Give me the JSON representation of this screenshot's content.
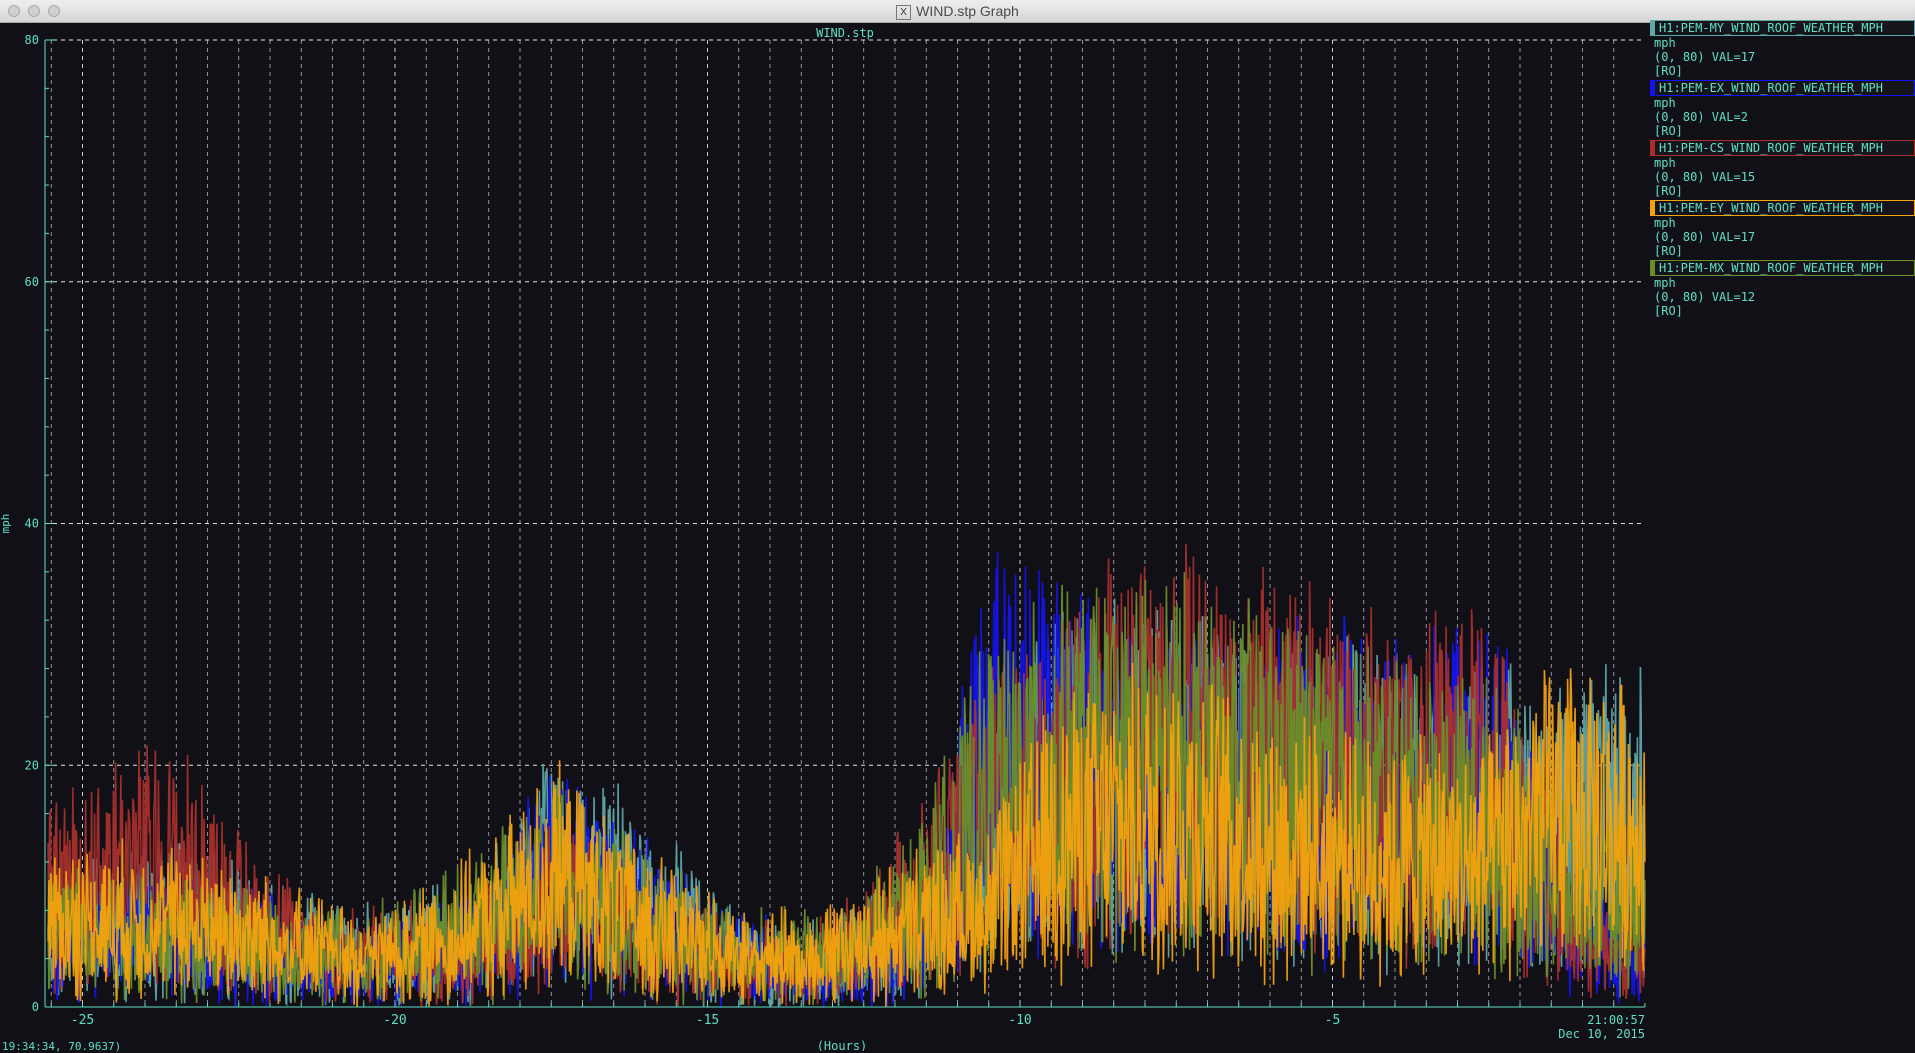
{
  "window": {
    "title": "WIND.stp Graph"
  },
  "chart_data": {
    "type": "line",
    "title": "WIND.stp",
    "xlabel": "(Hours)",
    "ylabel": "mph",
    "xlim": [
      -25.6,
      0
    ],
    "ylim": [
      0,
      80
    ],
    "grid": true,
    "x_ticks": [
      -25,
      -20,
      -15,
      -10,
      -5
    ],
    "x_tick_labels": [
      "-25",
      "-20",
      "-15",
      "-10",
      "-5"
    ],
    "y_ticks": [
      0,
      20,
      40,
      60,
      80
    ],
    "y_tick_labels": [
      "0",
      "20",
      "40",
      "60",
      "80"
    ],
    "legend_position": "right",
    "x": [
      -25.5,
      -24.5,
      -23.5,
      -22.5,
      -21.5,
      -20.5,
      -19.5,
      -18.5,
      -17.5,
      -16.5,
      -15.5,
      -14.5,
      -13.5,
      -12.5,
      -11.5,
      -10.5,
      -9.5,
      -8.5,
      -7.5,
      -6.5,
      -5.5,
      -4.5,
      -3.5,
      -2.5,
      -1.5,
      -0.5
    ],
    "series": [
      {
        "name": "H1:PEM-MY_WIND_ROOF_WEATHER_MPH",
        "color": "#5fa7a9",
        "values": [
          6,
          7,
          7,
          6,
          5,
          4,
          5,
          6,
          12,
          10,
          7,
          4,
          3,
          4,
          6,
          15,
          18,
          20,
          19,
          18,
          17,
          17,
          16,
          16,
          15,
          16
        ]
      },
      {
        "name": "H1:PEM-EX_WIND_ROOF_WEATHER_MPH",
        "color": "#1414f0",
        "values": [
          5,
          6,
          6,
          5,
          4,
          3,
          4,
          6,
          11,
          9,
          6,
          4,
          3,
          3,
          5,
          22,
          20,
          19,
          18,
          17,
          18,
          18,
          17,
          19,
          10,
          4
        ]
      },
      {
        "name": "H1:PEM-CS_WIND_ROOF_WEATHER_MPH",
        "color": "#a8302c",
        "values": [
          9,
          12,
          12,
          8,
          5,
          4,
          4,
          5,
          9,
          7,
          5,
          3,
          3,
          5,
          10,
          16,
          17,
          21,
          22,
          20,
          20,
          19,
          18,
          19,
          9,
          4
        ]
      },
      {
        "name": "H1:PEM-EY_WIND_ROOF_WEATHER_MPH",
        "color": "#f3a20e",
        "values": [
          7,
          7,
          7,
          6,
          5,
          4,
          5,
          7,
          11,
          8,
          6,
          4,
          4,
          5,
          7,
          8,
          14,
          15,
          16,
          14,
          13,
          12,
          12,
          12,
          16,
          15
        ]
      },
      {
        "name": "H1:PEM-MX_WIND_ROOF_WEATHER_MPH",
        "color": "#6a8f2a",
        "values": [
          6,
          6,
          6,
          5,
          4,
          4,
          5,
          7,
          11,
          8,
          6,
          4,
          4,
          5,
          9,
          17,
          19,
          20,
          20,
          19,
          18,
          17,
          16,
          15,
          11,
          8
        ]
      }
    ]
  },
  "legend": [
    {
      "name": "H1:PEM-MY_WIND_ROOF_WEATHER_MPH",
      "unit": "mph",
      "range": "(0, 80) VAL=17",
      "mode": "[RO]",
      "color": "#5ee0c4",
      "swatch": "#5fa7a9"
    },
    {
      "name": "H1:PEM-EX_WIND_ROOF_WEATHER_MPH",
      "unit": "mph",
      "range": "(0, 80) VAL=2",
      "mode": "[RO]",
      "color": "#5ee0c4",
      "swatch": "#1414f0"
    },
    {
      "name": "H1:PEM-CS_WIND_ROOF_WEATHER_MPH",
      "unit": "mph",
      "range": "(0, 80) VAL=15",
      "mode": "[RO]",
      "color": "#5ee0c4",
      "swatch": "#a8302c"
    },
    {
      "name": "H1:PEM-EY_WIND_ROOF_WEATHER_MPH",
      "unit": "mph",
      "range": "(0, 80) VAL=17",
      "mode": "[RO]",
      "color": "#5ee0c4",
      "swatch": "#f3a20e"
    },
    {
      "name": "H1:PEM-MX_WIND_ROOF_WEATHER_MPH",
      "unit": "mph",
      "range": "(0, 80) VAL=12",
      "mode": "[RO]",
      "color": "#5ee0c4",
      "swatch": "#6a8f2a"
    }
  ],
  "timestamp": {
    "time": "21:00:57",
    "date": "Dec 10, 2015"
  },
  "status": {
    "cursor": "19:34:34, 70.9637)"
  }
}
